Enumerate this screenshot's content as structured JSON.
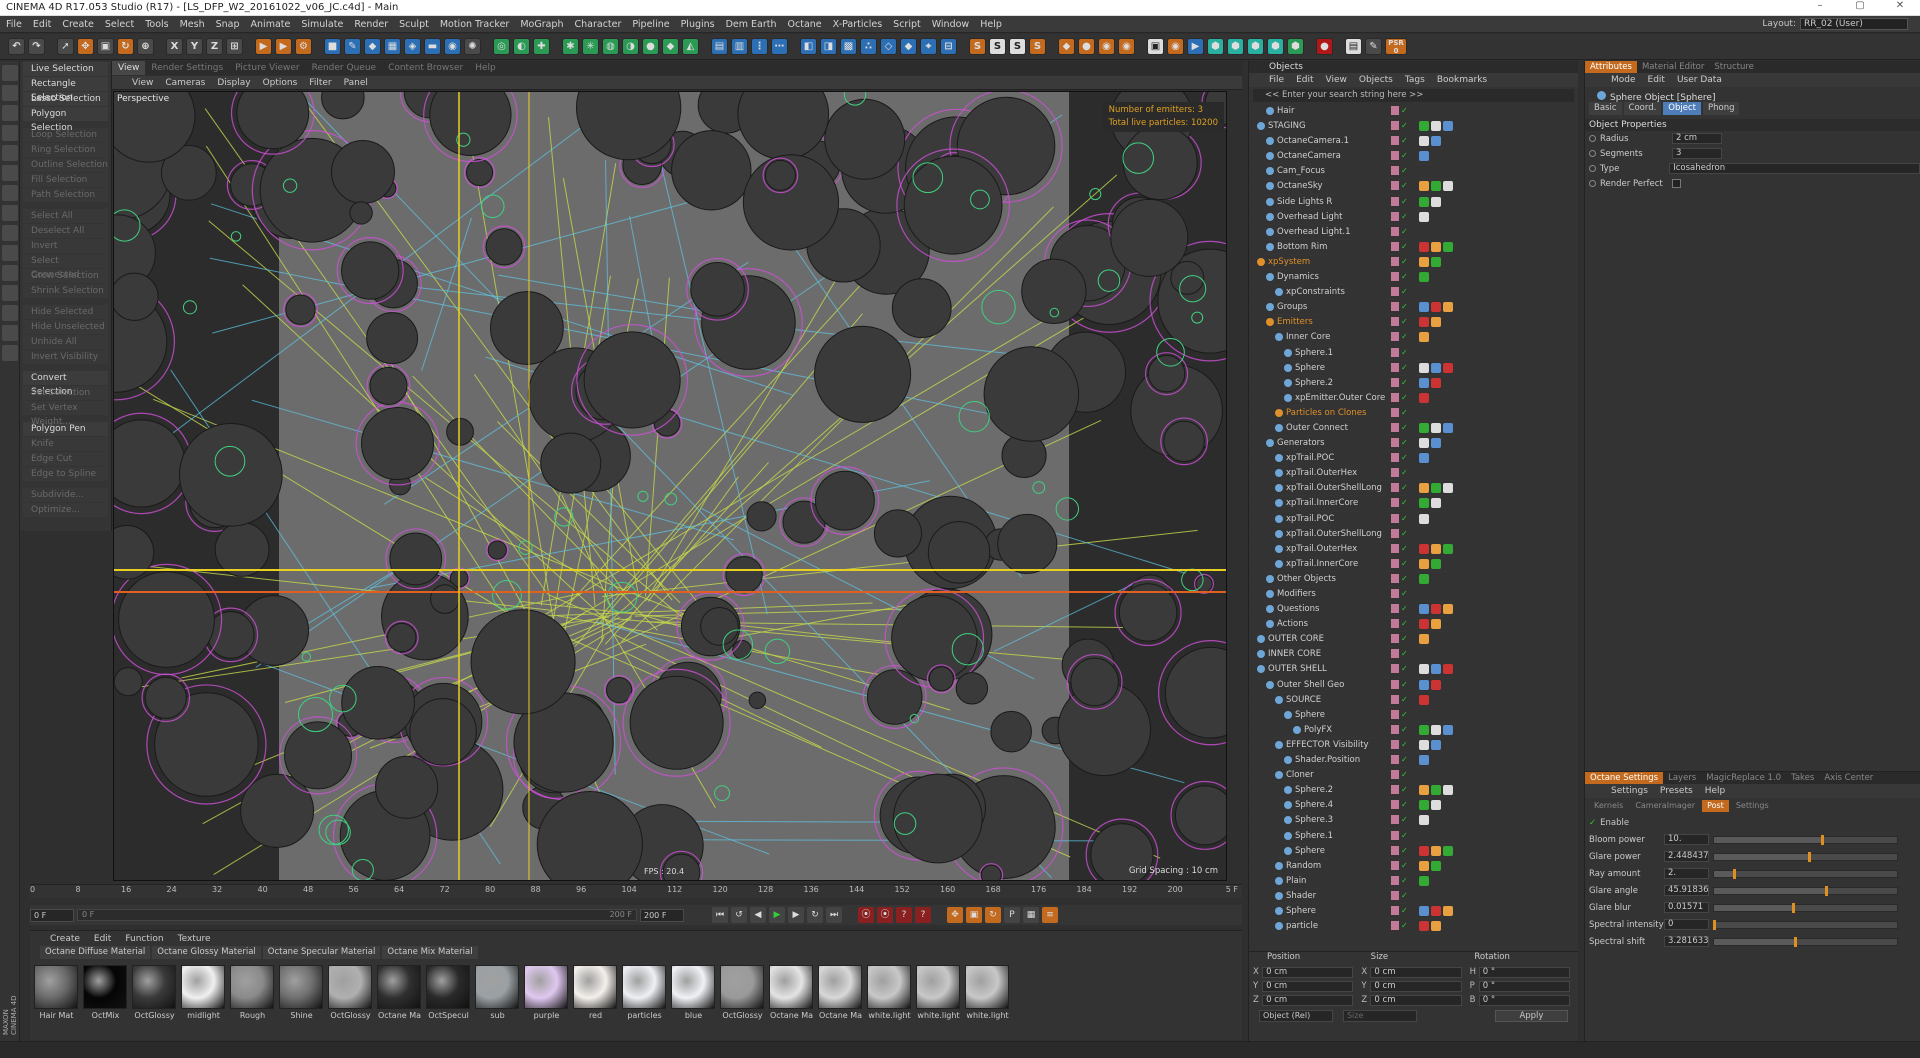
{
  "window": {
    "title": "CINEMA 4D R17.053 Studio (R17) - [LS_DFP_W2_20161022_v06_JC.c4d] - Main"
  },
  "menu": [
    "File",
    "Edit",
    "Create",
    "Select",
    "Tools",
    "Mesh",
    "Snap",
    "Animate",
    "Simulate",
    "Render",
    "Sculpt",
    "Motion Tracker",
    "MoGraph",
    "Character",
    "Pipeline",
    "Plugins",
    "Dem Earth",
    "Octane",
    "X-Particles",
    "Script",
    "Window",
    "Help"
  ],
  "layout": {
    "label": "Layout:",
    "value": "RR_02 (User)"
  },
  "toolbar": {
    "axis_x": "X",
    "axis_y": "Y",
    "axis_z": "Z",
    "s1": "S",
    "s2": "S",
    "s3": "S",
    "s4": "S",
    "psr": "PSR",
    "psr_val": "0"
  },
  "selection_menu": [
    {
      "label": "Live Selection",
      "enabled": true
    },
    {
      "label": "Rectangle Selection",
      "enabled": true
    },
    {
      "label": "Lasso Selection",
      "enabled": true
    },
    {
      "label": "Polygon Selection",
      "enabled": true
    },
    {
      "gap": true
    },
    {
      "label": "Loop Selection",
      "enabled": false
    },
    {
      "label": "Ring Selection",
      "enabled": false
    },
    {
      "label": "Outline Selection",
      "enabled": false
    },
    {
      "label": "Fill Selection",
      "enabled": false
    },
    {
      "label": "Path Selection",
      "enabled": false
    },
    {
      "gap": true
    },
    {
      "label": "Select All",
      "enabled": false
    },
    {
      "label": "Deselect All",
      "enabled": false
    },
    {
      "label": "Invert",
      "enabled": false
    },
    {
      "label": "Select Connected",
      "enabled": false
    },
    {
      "label": "Grow Selection",
      "enabled": false
    },
    {
      "label": "Shrink Selection",
      "enabled": false
    },
    {
      "gap": true
    },
    {
      "label": "Hide Selected",
      "enabled": false
    },
    {
      "label": "Hide Unselected",
      "enabled": false
    },
    {
      "label": "Unhide All",
      "enabled": false
    },
    {
      "label": "Invert Visibility",
      "enabled": false
    },
    {
      "gap": true
    },
    {
      "label": "Convert Selection",
      "enabled": true
    },
    {
      "label": "Set Selection",
      "enabled": false
    },
    {
      "label": "Set Vertex Weight...",
      "enabled": false
    },
    {
      "gap": true
    },
    {
      "label": "Polygon Pen",
      "enabled": true
    },
    {
      "label": "Knife",
      "enabled": false
    },
    {
      "label": "Edge Cut",
      "enabled": false
    },
    {
      "label": "Edge to Spline",
      "enabled": false
    },
    {
      "gap": true
    },
    {
      "label": "Subdivide...",
      "enabled": false
    },
    {
      "label": "Optimize...",
      "enabled": false
    }
  ],
  "viewport_tabs": [
    {
      "label": "View",
      "active": true
    },
    {
      "label": "Render Settings",
      "active": false
    },
    {
      "label": "Picture Viewer",
      "active": false
    },
    {
      "label": "Render Queue",
      "active": false
    },
    {
      "label": "Content Browser",
      "active": false
    },
    {
      "label": "Help",
      "active": false
    }
  ],
  "viewport_menu": [
    "View",
    "Cameras",
    "Display",
    "Options",
    "Filter",
    "Panel"
  ],
  "viewport": {
    "label": "Perspective",
    "emitters": "Number of emitters: 3",
    "particles": "Total live particles: 10200",
    "grid_spacing": "Grid Spacing : 10 cm",
    "fps": "FPS : 20.4"
  },
  "timeline": {
    "ticks": [
      "0",
      "8",
      "16",
      "24",
      "32",
      "40",
      "48",
      "56",
      "64",
      "72",
      "80",
      "88",
      "96",
      "104",
      "112",
      "120",
      "128",
      "136",
      "144",
      "152",
      "160",
      "168",
      "176",
      "184",
      "192",
      "200"
    ],
    "current": "5 F"
  },
  "transport": {
    "start": "0 F",
    "range_start": "0 F",
    "range_end": "200 F",
    "end": "200 F"
  },
  "material_manager": {
    "menu": [
      "Create",
      "Edit",
      "Function",
      "Texture"
    ],
    "tabs": [
      "Octane Diffuse Material",
      "Octane Glossy Material",
      "Octane Specular Material",
      "Octane Mix Material"
    ],
    "materials": [
      {
        "name": "Hair Mat",
        "color": "#6a6a6a"
      },
      {
        "name": "OctMix",
        "color": "#050505"
      },
      {
        "name": "OctGlossy",
        "color": "#3a3a3a"
      },
      {
        "name": "midlight",
        "color": "#f0f0f0"
      },
      {
        "name": "Rough",
        "color": "#8a8a8a"
      },
      {
        "name": "Shine",
        "color": "#707070"
      },
      {
        "name": "OctGlossy",
        "color": "#b0b0b0"
      },
      {
        "name": "Octane Ma",
        "color": "#303030"
      },
      {
        "name": "OctSpecul",
        "color": "#2a2a2a"
      },
      {
        "name": "sub",
        "color": "#9aa0a4"
      },
      {
        "name": "purple",
        "color": "#e0c8f0"
      },
      {
        "name": "red",
        "color": "#f4f0ec"
      },
      {
        "name": "particles",
        "color": "#eef0f4"
      },
      {
        "name": "blue",
        "color": "#f0f2f6"
      },
      {
        "name": "OctGlossy",
        "color": "#9a9a9a"
      },
      {
        "name": "Octane Ma",
        "color": "#e4e4e4"
      },
      {
        "name": "Octane Ma",
        "color": "#d8d8d8"
      },
      {
        "name": "white.light",
        "color": "#c8c8c8"
      },
      {
        "name": "white.light",
        "color": "#c8c8c8"
      },
      {
        "name": "white.light",
        "color": "#c8c8c8"
      }
    ]
  },
  "objects": {
    "header": "Objects",
    "menu": [
      "File",
      "Edit",
      "View",
      "Objects",
      "Tags",
      "Bookmarks"
    ],
    "search_placeholder": "<< Enter your search string here >>",
    "items": [
      {
        "name": "Hair",
        "indent": 1,
        "hl": false
      },
      {
        "name": "STAGING",
        "indent": 0,
        "hl": false
      },
      {
        "name": "OctaneCamera.1",
        "indent": 1,
        "hl": false
      },
      {
        "name": "OctaneCamera",
        "indent": 1,
        "hl": false
      },
      {
        "name": "Cam_Focus",
        "indent": 1,
        "hl": false
      },
      {
        "name": "OctaneSky",
        "indent": 1,
        "hl": false
      },
      {
        "name": "Side Lights R",
        "indent": 1,
        "hl": false
      },
      {
        "name": "Overhead Light",
        "indent": 1,
        "hl": false
      },
      {
        "name": "Overhead Light.1",
        "indent": 1,
        "hl": false
      },
      {
        "name": "Bottom Rim",
        "indent": 1,
        "hl": false
      },
      {
        "name": "xpSystem",
        "indent": 0,
        "hl": true
      },
      {
        "name": "Dynamics",
        "indent": 1,
        "hl": false
      },
      {
        "name": "xpConstraints",
        "indent": 2,
        "hl": false
      },
      {
        "name": "Groups",
        "indent": 1,
        "hl": false
      },
      {
        "name": "Emitters",
        "indent": 1,
        "hl": true
      },
      {
        "name": "Inner Core",
        "indent": 2,
        "hl": false
      },
      {
        "name": "Sphere.1",
        "indent": 3,
        "hl": false
      },
      {
        "name": "Sphere",
        "indent": 3,
        "hl": false
      },
      {
        "name": "Sphere.2",
        "indent": 3,
        "hl": false
      },
      {
        "name": "xpEmitter.Outer Core",
        "indent": 3,
        "hl": false
      },
      {
        "name": "Particles on Clones",
        "indent": 2,
        "hl": true
      },
      {
        "name": "Outer Connect",
        "indent": 2,
        "hl": false
      },
      {
        "name": "Generators",
        "indent": 1,
        "hl": false
      },
      {
        "name": "xpTrail.POC",
        "indent": 2,
        "hl": false
      },
      {
        "name": "xpTrail.OuterHex",
        "indent": 2,
        "hl": false
      },
      {
        "name": "xpTrail.OuterShellLong",
        "indent": 2,
        "hl": false
      },
      {
        "name": "xpTrail.InnerCore",
        "indent": 2,
        "hl": false
      },
      {
        "name": "xpTrail.POC",
        "indent": 2,
        "hl": false
      },
      {
        "name": "xpTrail.OuterShellLong",
        "indent": 2,
        "hl": false
      },
      {
        "name": "xpTrail.OuterHex",
        "indent": 2,
        "hl": false
      },
      {
        "name": "xpTrail.InnerCore",
        "indent": 2,
        "hl": false
      },
      {
        "name": "Other Objects",
        "indent": 1,
        "hl": false
      },
      {
        "name": "Modifiers",
        "indent": 1,
        "hl": false
      },
      {
        "name": "Questions",
        "indent": 1,
        "hl": false
      },
      {
        "name": "Actions",
        "indent": 1,
        "hl": false
      },
      {
        "name": "OUTER CORE",
        "indent": 0,
        "hl": false
      },
      {
        "name": "INNER CORE",
        "indent": 0,
        "hl": false
      },
      {
        "name": "OUTER SHELL",
        "indent": 0,
        "hl": false
      },
      {
        "name": "Outer Shell Geo",
        "indent": 1,
        "hl": false
      },
      {
        "name": "SOURCE",
        "indent": 2,
        "hl": false
      },
      {
        "name": "Sphere",
        "indent": 3,
        "hl": false
      },
      {
        "name": "PolyFX",
        "indent": 4,
        "hl": false
      },
      {
        "name": "EFFECTOR Visibility",
        "indent": 2,
        "hl": false
      },
      {
        "name": "Shader.Position",
        "indent": 3,
        "hl": false
      },
      {
        "name": "Cloner",
        "indent": 2,
        "hl": false
      },
      {
        "name": "Sphere.2",
        "indent": 3,
        "hl": false
      },
      {
        "name": "Sphere.4",
        "indent": 3,
        "hl": false
      },
      {
        "name": "Sphere.3",
        "indent": 3,
        "hl": false
      },
      {
        "name": "Sphere.1",
        "indent": 3,
        "hl": false
      },
      {
        "name": "Sphere",
        "indent": 3,
        "hl": false
      },
      {
        "name": "Random",
        "indent": 2,
        "hl": false
      },
      {
        "name": "Plain",
        "indent": 2,
        "hl": false
      },
      {
        "name": "Shader",
        "indent": 2,
        "hl": false
      },
      {
        "name": "Sphere",
        "indent": 2,
        "hl": false
      },
      {
        "name": "particle",
        "indent": 2,
        "hl": false
      }
    ]
  },
  "coords": {
    "headers": [
      "Position",
      "Size",
      "Rotation"
    ],
    "rows": [
      {
        "axis": "X",
        "pos": "0 cm",
        "size": "0 cm",
        "rlabel": "H",
        "rot": "0 °"
      },
      {
        "axis": "Y",
        "pos": "0 cm",
        "size": "0 cm",
        "rlabel": "P",
        "rot": "0 °"
      },
      {
        "axis": "Z",
        "pos": "0 cm",
        "size": "0 cm",
        "rlabel": "B",
        "rot": "0 °"
      }
    ],
    "mode": "Object (Rel)",
    "size_mode": "Size",
    "apply": "Apply"
  },
  "attributes": {
    "tabs": [
      {
        "label": "Attributes",
        "active": true
      },
      {
        "label": "Material Editor",
        "active": false
      },
      {
        "label": "Structure",
        "active": false
      }
    ],
    "menu": [
      "Mode",
      "Edit",
      "User Data"
    ],
    "title": "Sphere Object [Sphere]",
    "subtabs": [
      {
        "label": "Basic",
        "active": false
      },
      {
        "label": "Coord.",
        "active": false
      },
      {
        "label": "Object",
        "active": true
      },
      {
        "label": "Phong",
        "active": false
      }
    ],
    "section": "Object Properties",
    "fields": [
      {
        "label": "Radius",
        "value": "2 cm"
      },
      {
        "label": "Segments",
        "value": "3"
      },
      {
        "label": "Type",
        "value": "Icosahedron"
      },
      {
        "label": "Render Perfect",
        "value": ""
      }
    ]
  },
  "octane": {
    "tabs": [
      {
        "label": "Octane Settings",
        "active": true
      },
      {
        "label": "Layers",
        "active": false
      },
      {
        "label": "MagicReplace 1.0",
        "active": false
      },
      {
        "label": "Takes",
        "active": false
      },
      {
        "label": "Axis Center",
        "active": false
      }
    ],
    "menu": [
      "Settings",
      "Presets",
      "Help"
    ],
    "subtabs": [
      {
        "label": "Kernels",
        "active": false
      },
      {
        "label": "CameraImager",
        "active": false
      },
      {
        "label": "Post",
        "active": true
      },
      {
        "label": "Settings",
        "active": false
      }
    ],
    "enable": "Enable",
    "params": [
      {
        "label": "Bloom power",
        "value": "10.",
        "level": 0.59
      },
      {
        "label": "Glare power",
        "value": "2.448437",
        "level": 0.52
      },
      {
        "label": "Ray amount",
        "value": "2.",
        "level": 0.11
      },
      {
        "label": "Glare angle",
        "value": "45.91836",
        "level": 0.61
      },
      {
        "label": "Glare blur",
        "value": "0.01571",
        "level": 0.43
      },
      {
        "label": "Spectral intensity",
        "value": "0",
        "level": 0.0
      },
      {
        "label": "Spectral shift",
        "value": "3.281633",
        "level": 0.44
      }
    ]
  },
  "maxon": "MAXON CINEMA 4D"
}
